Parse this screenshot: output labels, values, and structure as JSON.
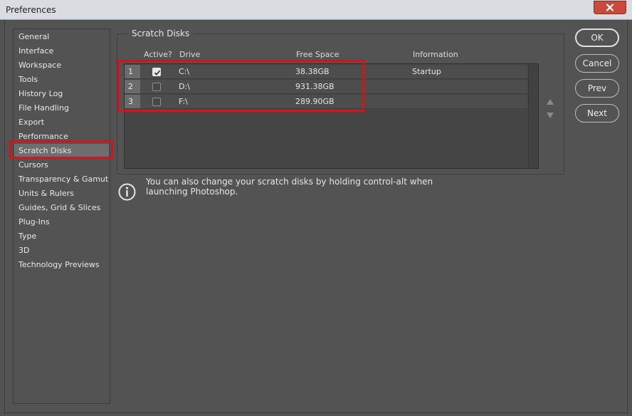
{
  "window": {
    "title": "Preferences"
  },
  "sidebar": {
    "items": [
      {
        "label": "General"
      },
      {
        "label": "Interface"
      },
      {
        "label": "Workspace"
      },
      {
        "label": "Tools"
      },
      {
        "label": "History Log"
      },
      {
        "label": "File Handling"
      },
      {
        "label": "Export"
      },
      {
        "label": "Performance"
      },
      {
        "label": "Scratch Disks",
        "selected": true
      },
      {
        "label": "Cursors"
      },
      {
        "label": "Transparency & Gamut"
      },
      {
        "label": "Units & Rulers"
      },
      {
        "label": "Guides, Grid & Slices"
      },
      {
        "label": "Plug-Ins"
      },
      {
        "label": "Type"
      },
      {
        "label": "3D"
      },
      {
        "label": "Technology Previews"
      }
    ]
  },
  "scratch": {
    "title": "Scratch Disks",
    "columns": {
      "active": "Active?",
      "drive": "Drive",
      "free": "Free Space",
      "info": "Information"
    },
    "rows": [
      {
        "num": "1",
        "active": true,
        "drive": "C:\\",
        "free": "38.38GB",
        "info": "Startup"
      },
      {
        "num": "2",
        "active": false,
        "drive": "D:\\",
        "free": "931.38GB",
        "info": ""
      },
      {
        "num": "3",
        "active": false,
        "drive": "F:\\",
        "free": "289.90GB",
        "info": ""
      }
    ]
  },
  "info": {
    "text": "You can also change your scratch disks by holding control-alt when launching Photoshop."
  },
  "buttons": {
    "ok": "OK",
    "cancel": "Cancel",
    "prev": "Prev",
    "next": "Next"
  },
  "colors": {
    "highlight": "#d4141b",
    "close": "#c74a3b",
    "background": "#535353"
  }
}
